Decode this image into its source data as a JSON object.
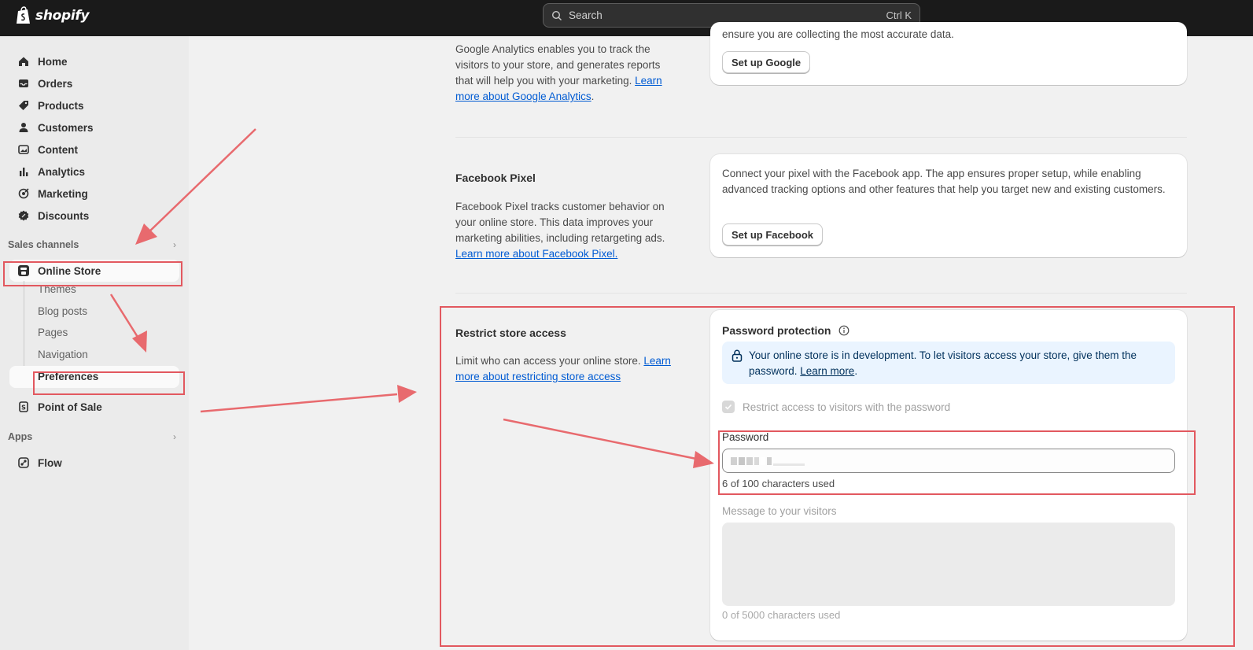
{
  "topbar": {
    "logo_text": "shopify",
    "search_placeholder": "Search",
    "search_shortcut": "Ctrl K"
  },
  "sidebar": {
    "items": [
      {
        "label": "Home",
        "icon": "home-icon"
      },
      {
        "label": "Orders",
        "icon": "inbox-icon"
      },
      {
        "label": "Products",
        "icon": "tag-icon"
      },
      {
        "label": "Customers",
        "icon": "person-icon"
      },
      {
        "label": "Content",
        "icon": "image-icon"
      },
      {
        "label": "Analytics",
        "icon": "bar-chart-icon"
      },
      {
        "label": "Marketing",
        "icon": "target-icon"
      },
      {
        "label": "Discounts",
        "icon": "discount-icon"
      }
    ],
    "sales_channels_label": "Sales channels",
    "online_store_label": "Online Store",
    "online_store_subitems": [
      "Themes",
      "Blog posts",
      "Pages",
      "Navigation"
    ],
    "preferences_label": "Preferences",
    "point_of_sale_label": "Point of Sale",
    "apps_label": "Apps",
    "flow_label": "Flow"
  },
  "google": {
    "desc_text": "Google Analytics enables you to track the visitors to your store, and generates reports that will help you with your marketing. ",
    "desc_link": "Learn more about Google Analytics",
    "desc_suffix": ".",
    "card_partial_text": "ensure you are collecting the most accurate data.",
    "button_label": "Set up Google"
  },
  "facebook": {
    "title": "Facebook Pixel",
    "desc_text": "Facebook Pixel tracks customer behavior on your online store. This data improves your marketing abilities, including retargeting ads. ",
    "desc_link": "Learn more about Facebook Pixel.",
    "card_text": "Connect your pixel with the Facebook app. The app ensures proper setup, while enabling advanced tracking options and other features that help you target new and existing customers.",
    "button_label": "Set up Facebook"
  },
  "restrict": {
    "title": "Restrict store access",
    "desc_text": "Limit who can access your online store. ",
    "desc_link": "Learn more about restricting store access",
    "card_title": "Password protection",
    "banner_text": "Your online store is in development. To let visitors access your store, give them the password. ",
    "banner_link": "Learn more",
    "banner_suffix": ".",
    "checkbox_label": "Restrict access to visitors with the password",
    "checkbox_checked": true,
    "password_label": "Password",
    "password_counter": "6 of 100 characters used",
    "message_label": "Message to your visitors",
    "message_counter": "0 of 5000 characters used"
  },
  "colors": {
    "annotation_red": "#e2585f",
    "link_blue": "#005bd3",
    "topbar_bg": "#1a1a1a"
  }
}
